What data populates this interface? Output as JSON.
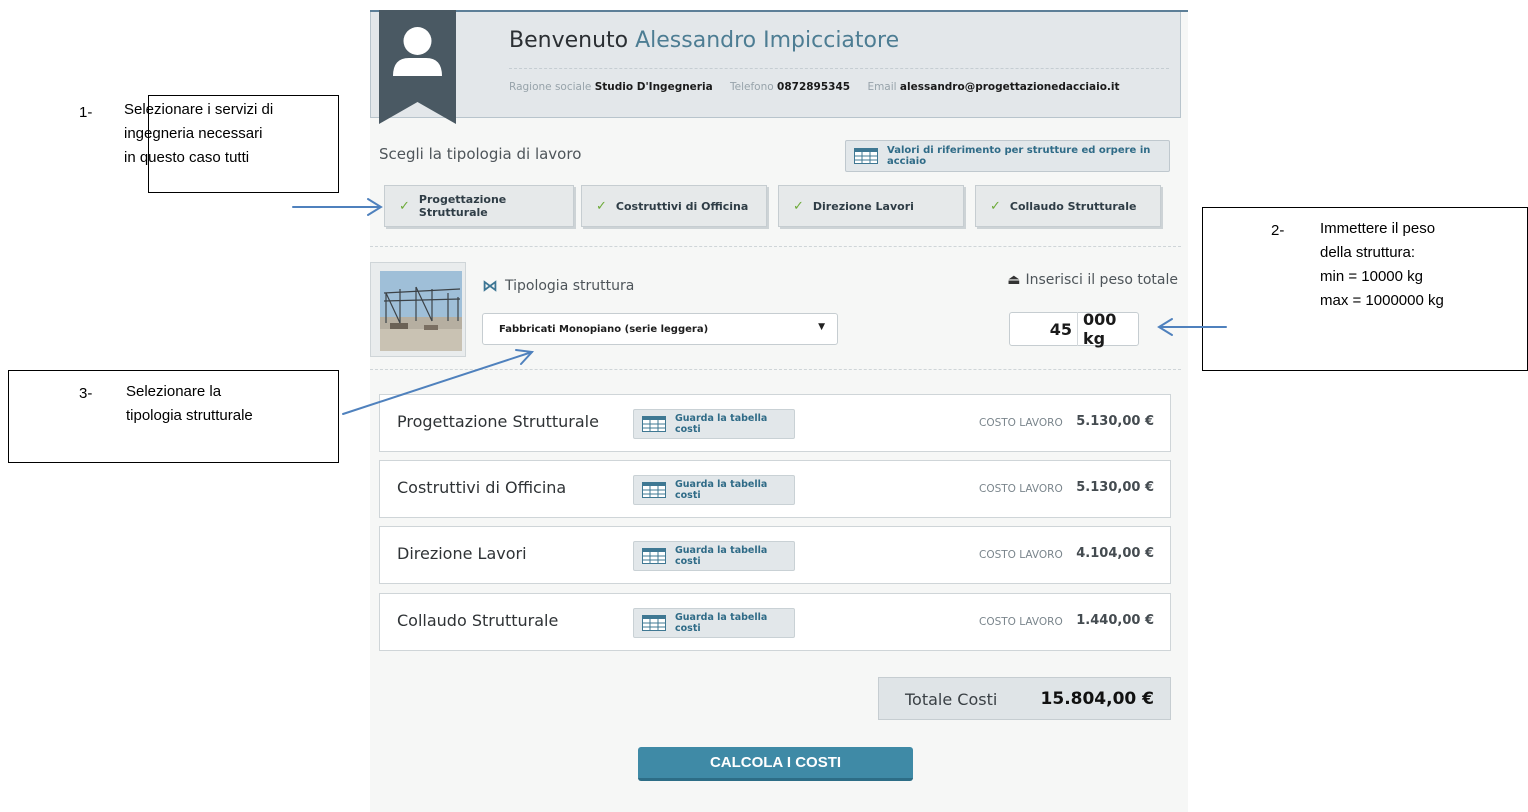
{
  "header": {
    "welcome_prefix": "Benvenuto",
    "user_name": "Alessandro Impicciatore",
    "company_label": "Ragione sociale",
    "company_value": "Studio D'Ingegneria",
    "phone_label": "Telefono",
    "phone_value": "0872895345",
    "email_label": "Email",
    "email_value": "alessandro@progettazionedacciaio.it"
  },
  "work_type": {
    "title": "Scegli la tipologia di lavoro",
    "reference_button": "Valori di riferimento per strutture ed orpere in acciaio",
    "services": [
      {
        "label": "Progettazione Strutturale",
        "checked": true
      },
      {
        "label": "Costruttivi di Officina",
        "checked": true
      },
      {
        "label": "Direzione Lavori",
        "checked": true
      },
      {
        "label": "Collaudo Strutturale",
        "checked": true
      }
    ]
  },
  "structure": {
    "type_label": "Tipologia struttura",
    "type_icon": "bowtie-icon",
    "selected_type": "Fabbricati Monopiano (serie leggera)",
    "weight_label": "Inserisci il peso totale",
    "weight_icon": "weight-icon",
    "weight_value": "45",
    "weight_suffix": "000 kg"
  },
  "costs": {
    "table_button": "Guarda la tabella costi",
    "cost_label": "COSTO LAVORO",
    "rows": [
      {
        "name": "Progettazione Strutturale",
        "value": "5.130,00 €"
      },
      {
        "name": "Costruttivi di Officina",
        "value": "5.130,00 €"
      },
      {
        "name": "Direzione Lavori",
        "value": "4.104,00 €"
      },
      {
        "name": "Collaudo Strutturale",
        "value": "1.440,00 €"
      }
    ],
    "total_label": "Totale Costi",
    "total_value": "15.804,00 €"
  },
  "actions": {
    "calculate": "CALCOLA I COSTI"
  },
  "annotations": [
    {
      "number": "1-",
      "lines": [
        "Selezionare i servizi di",
        "ingegneria necessari",
        "in questo caso tutti"
      ]
    },
    {
      "number": "2-",
      "lines": [
        "Immettere il peso",
        "della struttura:",
        "min = 10000 kg",
        "max = 1000000 kg"
      ]
    },
    {
      "number": "3-",
      "lines": [
        "Selezionare la",
        "tipologia strutturale"
      ]
    }
  ],
  "colors": {
    "accent": "#3f8aa6",
    "link_blue": "#2f6b87",
    "check_green": "#6eab3a",
    "arrow_blue": "#4f81bd"
  }
}
